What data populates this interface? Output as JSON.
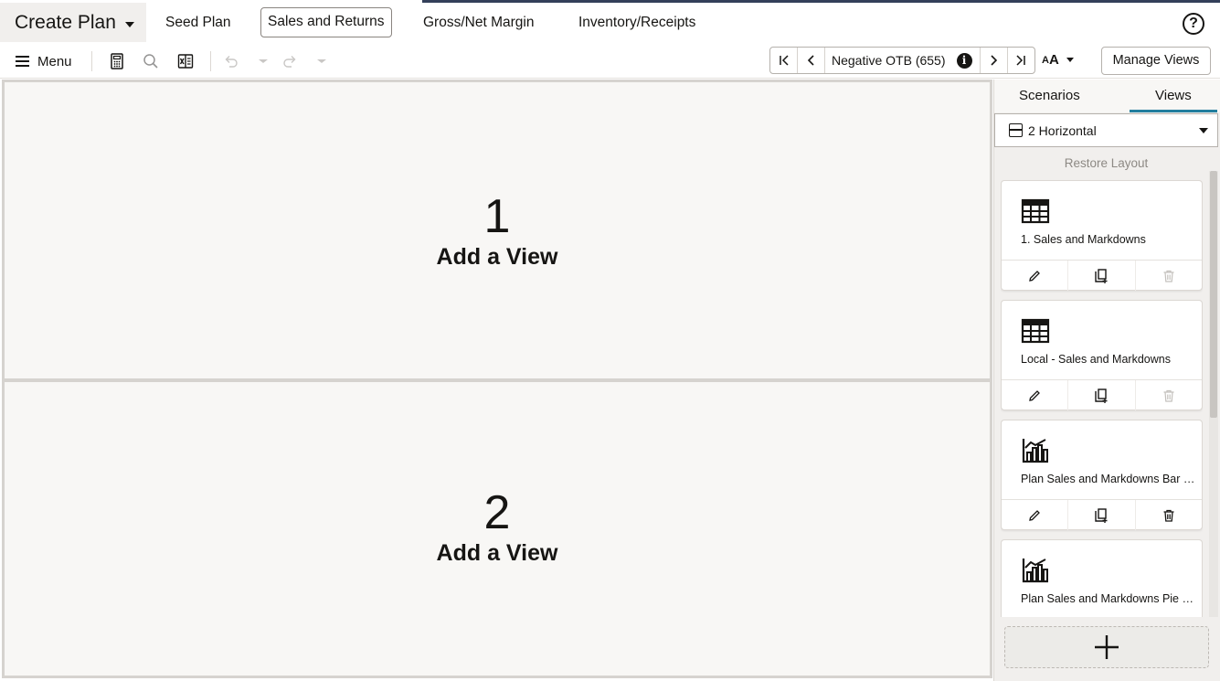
{
  "header": {
    "plan_title": "Create Plan",
    "tabs": [
      {
        "label": "Seed Plan"
      },
      {
        "label": "Sales and Returns"
      },
      {
        "label": "Gross/Net Margin"
      },
      {
        "label": "Inventory/Receipts"
      }
    ],
    "active_tab": "Sales and Returns",
    "help_glyph": "?"
  },
  "toolbar": {
    "menu_label": "Menu",
    "icons": [
      "calculator-icon",
      "search-icon",
      "excel-export-icon",
      "undo-icon",
      "undo-dropdown-icon",
      "redo-icon",
      "redo-dropdown-icon"
    ],
    "navigator": {
      "label": "Negative OTB (655)",
      "info_glyph": "i"
    },
    "font_size_small": "A",
    "font_size_large": "A",
    "manage_views_label": "Manage Views"
  },
  "canvas": {
    "panes": [
      {
        "number": "1",
        "label": "Add a View"
      },
      {
        "number": "2",
        "label": "Add a View"
      }
    ]
  },
  "right_panel": {
    "tabs": [
      {
        "label": "Scenarios"
      },
      {
        "label": "Views"
      }
    ],
    "active_tab": "Views",
    "layout_select_value": "2 Horizontal",
    "restore_label": "Restore Layout",
    "views": [
      {
        "name": "1. Sales and Markdowns",
        "icon": "table-icon",
        "delete_enabled": false
      },
      {
        "name": "Local - Sales and Markdowns",
        "icon": "table-icon",
        "delete_enabled": false
      },
      {
        "name": "Plan Sales and Markdowns Bar Chart",
        "icon": "bar-chart-icon",
        "delete_enabled": true
      },
      {
        "name": "Plan Sales and Markdowns Pie Chart",
        "icon": "bar-chart-icon",
        "delete_enabled": true
      }
    ],
    "add_view_glyph": "+"
  },
  "colors": {
    "accent": "#227e9e",
    "top_border": "#34405a",
    "canvas_bg": "#f8f7f5",
    "panel_bg": "#f1efed"
  }
}
